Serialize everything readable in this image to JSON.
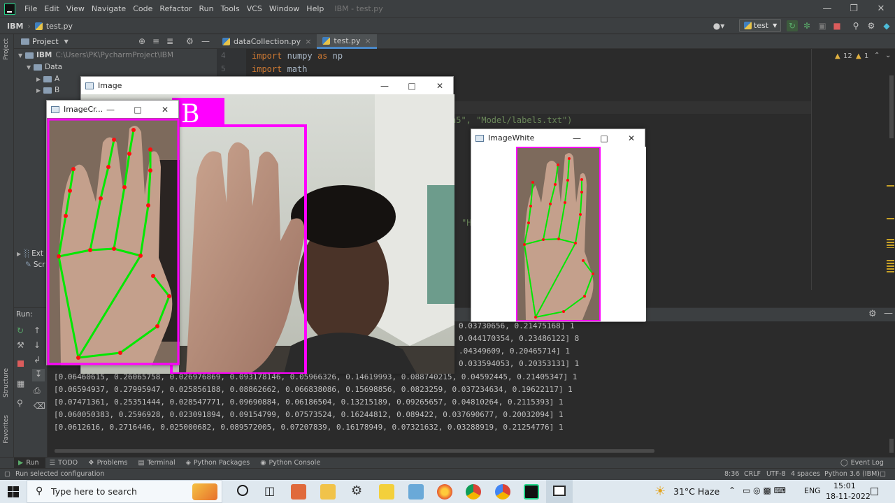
{
  "menubar": {
    "items": [
      "File",
      "Edit",
      "View",
      "Navigate",
      "Code",
      "Refactor",
      "Run",
      "Tools",
      "VCS",
      "Window",
      "Help"
    ],
    "title": "IBM - test.py"
  },
  "navbar": {
    "project": "IBM",
    "file": "test.py",
    "run_config": "test"
  },
  "project_panel": {
    "header": "Project",
    "root_name": "IBM",
    "root_path": "C:\\Users\\PK\\PycharmProject\\IBM",
    "items": [
      "Data",
      "A",
      "B",
      "Ext",
      "Scr"
    ]
  },
  "editor": {
    "tabs": [
      "dataCollection.py",
      "test.py"
    ],
    "lines": [
      {
        "num": "4",
        "kw": "import",
        "rest": " numpy ",
        "kw2": "as",
        "rest2": " np"
      },
      {
        "num": "5",
        "kw": "import",
        "rest": " math",
        "kw2": "",
        "rest2": ""
      }
    ],
    "fragment1": "h5\", \"Model/labels.txt\")",
    "fragment2": "\"H",
    "inspections": {
      "warnings": "12",
      "weak": "1"
    }
  },
  "run_panel": {
    "label": "Run:",
    "output": [
      "0.03730656, 0.21475168] 1",
      "0.044170354, 0.23486122] 8",
      ".04349609, 0.20465714] 1",
      "0.033594053, 0.20353131] 1",
      "[0.06460615, 0.26065758, 0.026976869, 0.093178146, 0.05966326, 0.14619993, 0.088740215, 0.04592445, 0.21405347] 1",
      "[0.06594937, 0.27995947, 0.025856188, 0.08862662, 0.066838086, 0.15698856, 0.0823259, 0.037234634, 0.19622117] 1",
      "[0.07471361, 0.25351444, 0.028547771, 0.09690884, 0.06186504, 0.13215189, 0.09265657, 0.04810264, 0.2115393] 1",
      "[0.060050383, 0.2596928, 0.023091894, 0.09154799, 0.07573524, 0.16244812, 0.089422, 0.037690677, 0.20032094] 1",
      "[0.0612616, 0.2716446, 0.025000682, 0.089572005, 0.07207839, 0.16178949, 0.07321632, 0.03288919, 0.21254776] 1"
    ]
  },
  "tool_tabs": [
    "Run",
    "TODO",
    "Problems",
    "Terminal",
    "Python Packages",
    "Python Console",
    "Event Log"
  ],
  "status": {
    "left": "Run selected configuration",
    "position": "8:36",
    "line_sep": "CRLF",
    "encoding": "UTF-8",
    "indent": "4 spaces",
    "interpreter": "Python 3.6 (IBM)"
  },
  "side_labels": {
    "project": "Project",
    "structure": "Structure",
    "favorites": "Favorites"
  },
  "windows": {
    "image": {
      "title": "Image",
      "label": "B"
    },
    "crop": {
      "title": "ImageCr..."
    },
    "white": {
      "title": "ImageWhite"
    }
  },
  "taskbar": {
    "search_placeholder": "Type here to search",
    "weather": "31°C  Haze",
    "lang": "ENG",
    "time": "15:01",
    "date": "18-11-2022"
  },
  "colors": {
    "accent": "#4a88c7",
    "bbox": "#ff00ff",
    "landmark_line": "#00ff00",
    "landmark_point": "#ff0000"
  }
}
